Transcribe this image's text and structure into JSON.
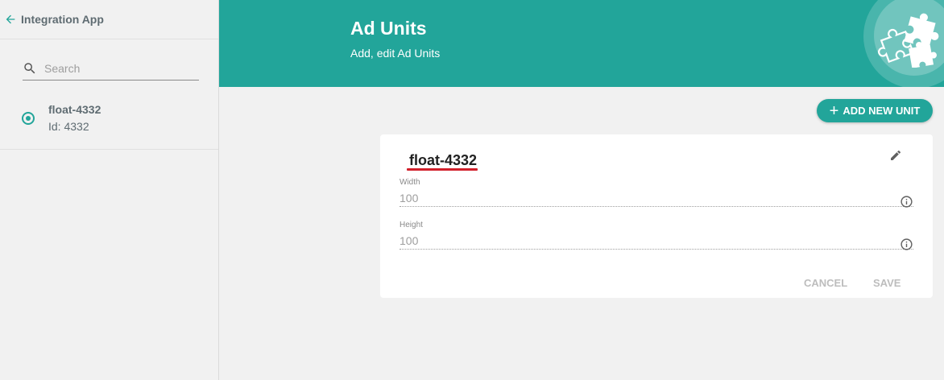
{
  "sidebar": {
    "back_label": "Integration App",
    "search_placeholder": "Search",
    "items": [
      {
        "name": "float-4332",
        "id_text": "Id: 4332",
        "selected": true
      }
    ]
  },
  "header": {
    "title": "Ad Units",
    "subtitle": "Add, edit Ad Units",
    "icon": "puzzle-icon"
  },
  "toolbar": {
    "add_label": "ADD NEW UNIT"
  },
  "card": {
    "title": "float-4332",
    "fields": [
      {
        "label": "Width",
        "value": "100"
      },
      {
        "label": "Height",
        "value": "100"
      }
    ],
    "cancel_label": "CANCEL",
    "save_label": "SAVE"
  },
  "colors": {
    "accent": "#22a59a",
    "title_underline": "#d11f2a",
    "background": "#f1f1f1"
  }
}
